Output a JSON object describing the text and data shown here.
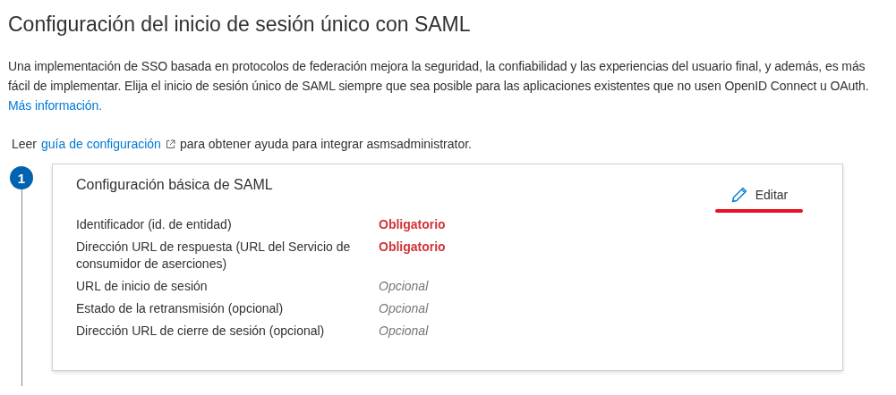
{
  "title": "Configuración del inicio de sesión único con SAML",
  "intro": {
    "text": "Una implementación de SSO basada en protocolos de federación mejora la seguridad, la confiabilidad y las experiencias del usuario final, y además, es más fácil de implementar. Elija el inicio de sesión único de SAML siempre que sea posible para las aplicaciones existentes que no usen OpenID Connect u OAuth.",
    "link": "Más información."
  },
  "guide": {
    "before": "Leer",
    "link": "guía de configuración",
    "after": "para obtener ayuda para integrar asmsadministrator."
  },
  "steps": [
    {
      "number": "1",
      "title": "Configuración básica de SAML",
      "edit_button": "Editar",
      "edit_highlighted": true,
      "fields": [
        {
          "label": "Identificador (id. de entidad)",
          "value": "Obligatorio",
          "kind": "required"
        },
        {
          "label": "Dirección URL de respuesta (URL del Servicio de consumidor de aserciones)",
          "value": "Obligatorio",
          "kind": "required"
        },
        {
          "label": "URL de inicio de sesión",
          "value": "Opcional",
          "kind": "optional"
        },
        {
          "label": "Estado de la retransmisión (opcional)",
          "value": "Opcional",
          "kind": "optional"
        },
        {
          "label": "Dirección URL de cierre de sesión (opcional)",
          "value": "Opcional",
          "kind": "optional"
        }
      ]
    }
  ]
}
